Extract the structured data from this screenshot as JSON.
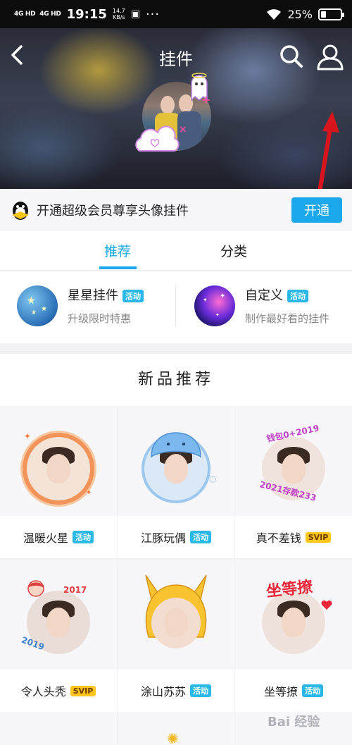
{
  "status_bar": {
    "network_1": "4G HD",
    "network_2": "4G HD",
    "time": "19:15",
    "speed_value": "14.7",
    "speed_unit": "KB/s",
    "battery_percent": "25%",
    "battery_level": 0.25
  },
  "header": {
    "title": "挂件"
  },
  "vip_bar": {
    "text": "开通超级会员尊享头像挂件",
    "button_label": "开通"
  },
  "tabs": [
    {
      "label": "推荐",
      "active": true
    },
    {
      "label": "分类",
      "active": false
    }
  ],
  "activities": [
    {
      "title": "星星挂件",
      "tag": "活动",
      "subtitle": "升级限时特惠"
    },
    {
      "title": "自定义",
      "tag": "活动",
      "subtitle": "制作最好看的挂件"
    }
  ],
  "new_section": {
    "title": "新品推荐"
  },
  "items": [
    {
      "name": "温暖火星",
      "badge": "活动"
    },
    {
      "name": "江豚玩偶",
      "badge": "活动"
    },
    {
      "name": "真不差钱",
      "badge": "SVIP"
    },
    {
      "name": "令人头秃",
      "badge": "SVIP"
    },
    {
      "name": "涂山苏苏",
      "badge": "活动"
    },
    {
      "name": "坐等撩",
      "badge": "活动"
    }
  ],
  "decor_text": {
    "money_top": "钱包0+2019",
    "money_bottom": "2021存款233",
    "year_top": "2017",
    "year_bottom": "2019",
    "waiting": "坐等撩"
  },
  "watermark": "Bai 经验",
  "colors": {
    "accent": "#1aa7ec",
    "tag_blue": "#2ab8e8",
    "svip_yellow": "#ffc51a"
  }
}
